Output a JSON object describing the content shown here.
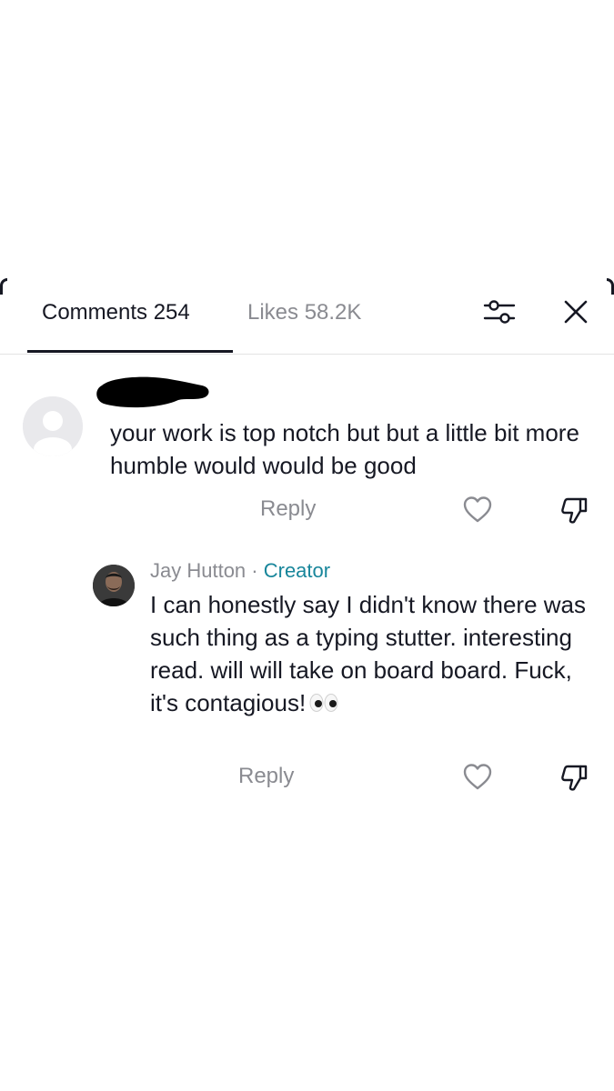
{
  "tabs": {
    "comments_label": "Comments 254",
    "likes_label": "Likes 58.2K"
  },
  "header": {
    "filter_icon": "sliders-icon",
    "close_icon": "close-icon"
  },
  "comments": [
    {
      "author_redacted": true,
      "avatar": "default-avatar-icon",
      "text": "your work is top notch but but a little bit more humble would would be good",
      "reply_label": "Reply",
      "like_icon": "heart-icon",
      "dislike_icon": "thumbs-down-icon",
      "replies": [
        {
          "author": "Jay Hutton",
          "separator": " · ",
          "badge": "Creator",
          "text": "I can honestly say I didn't know there was such thing as a typing stutter. interesting read. will will take on board board. Fuck, it's contagious!",
          "emoji_icon": "eyes-emoji-icon",
          "reply_label": "Reply",
          "like_icon": "heart-icon",
          "dislike_icon": "thumbs-down-icon"
        }
      ]
    }
  ],
  "colors": {
    "text_primary": "#161823",
    "text_secondary": "#8a8b91",
    "creator_badge": "#18869b",
    "divider": "#e3e3e4"
  }
}
